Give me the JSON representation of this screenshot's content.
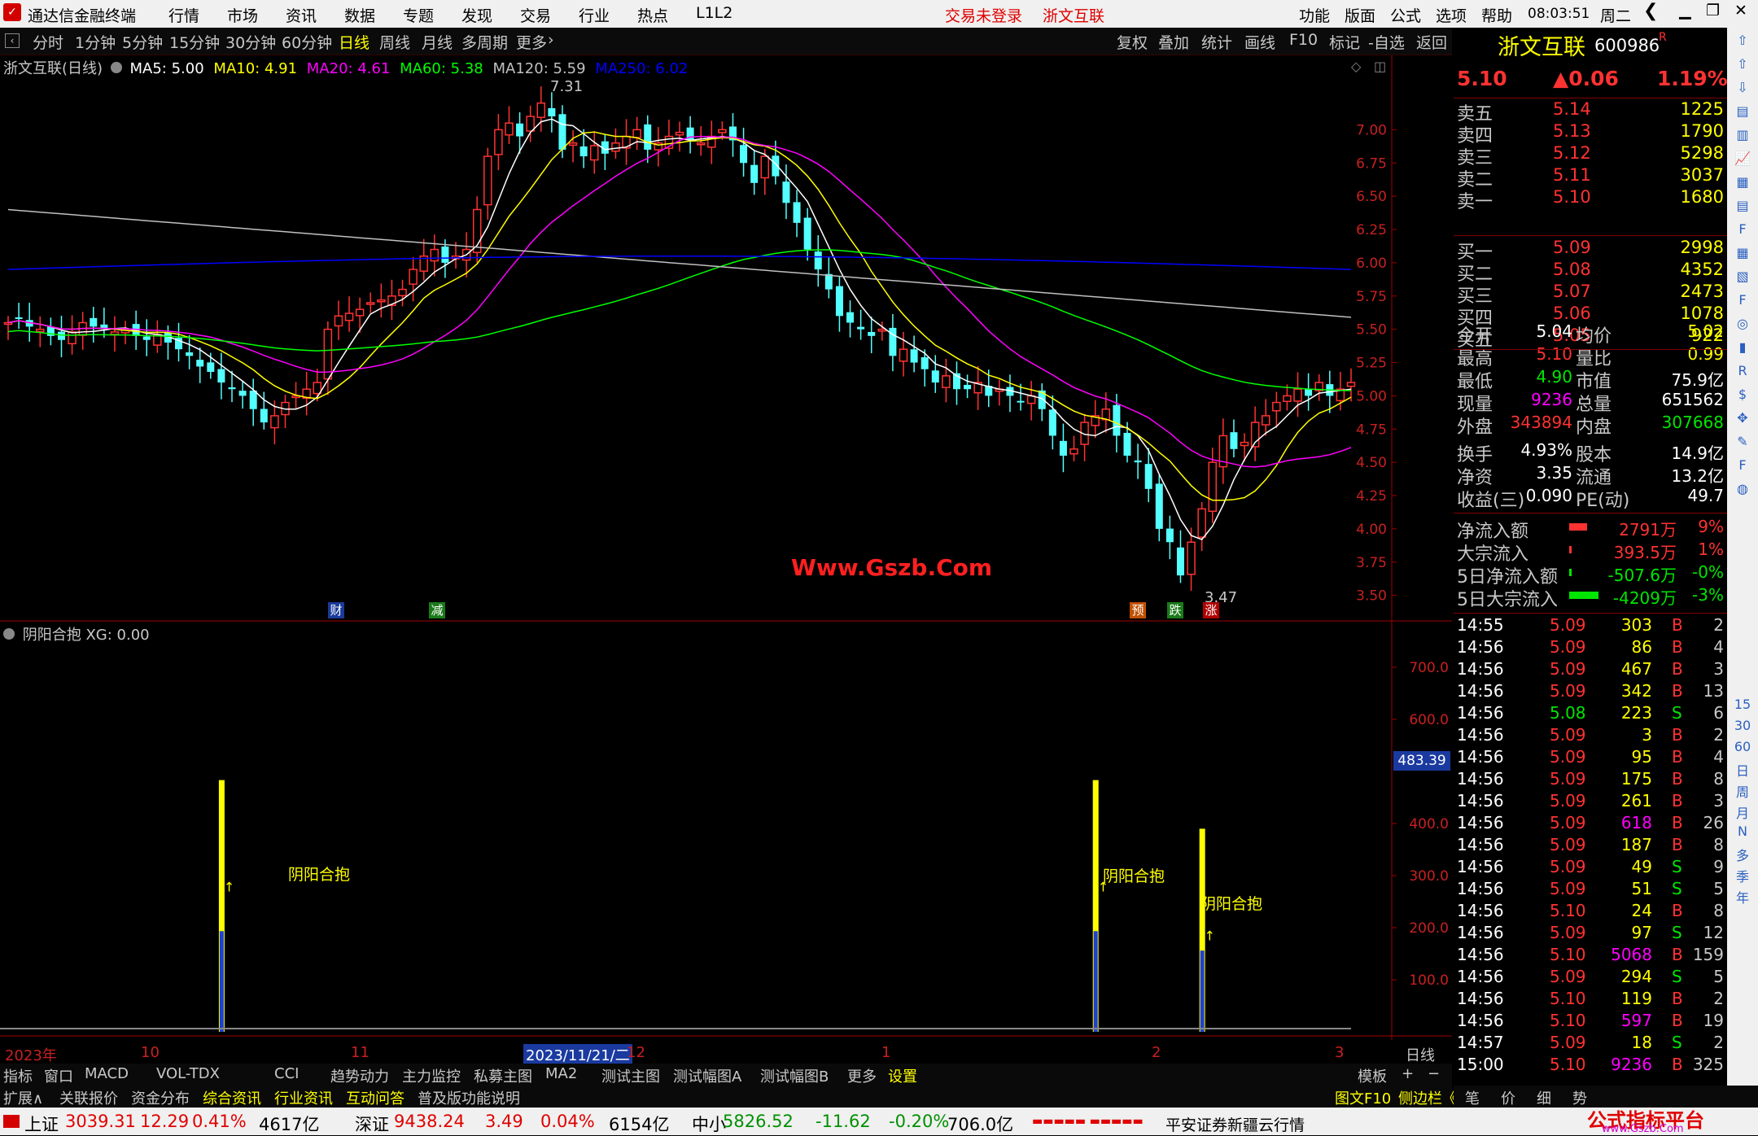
{
  "app": {
    "title": "通达信金融终端",
    "menu": [
      "行情",
      "市场",
      "资讯",
      "数据",
      "专题",
      "发现",
      "交易",
      "行业",
      "热点",
      "L1L2"
    ],
    "login_status": "交易未登录",
    "stock_title": "浙文互联",
    "right_menu": [
      "功能",
      "版面",
      "公式",
      "选项",
      "帮助"
    ],
    "time": "08:03:51",
    "weekday": "周二"
  },
  "periods": {
    "items": [
      "分时",
      "1分钟",
      "5分钟",
      "15分钟",
      "30分钟",
      "60分钟",
      "日线",
      "周线",
      "月线",
      "多周期",
      "更多"
    ],
    "active": "日线",
    "tools": [
      "复权",
      "叠加",
      "统计",
      "画线",
      "F10",
      "标记",
      "-自选",
      "返回"
    ]
  },
  "main_chart": {
    "name": "浙文互联(日线)",
    "ma": [
      {
        "label": "MA5: 5.00",
        "color": "#ffffff"
      },
      {
        "label": "MA10: 4.91",
        "color": "#ffff00"
      },
      {
        "label": "MA20: 4.61",
        "color": "#ff00ff"
      },
      {
        "label": "MA60: 5.38",
        "color": "#00ff00"
      },
      {
        "label": "MA120: 5.59",
        "color": "#c0c0c0"
      },
      {
        "label": "MA250: 6.02",
        "color": "#0000ff"
      }
    ],
    "y_ticks": [
      "7.00",
      "6.75",
      "6.50",
      "6.25",
      "6.00",
      "5.75",
      "5.50",
      "5.25",
      "5.00",
      "4.75",
      "4.50",
      "4.25",
      "4.00",
      "3.75",
      "3.50"
    ],
    "high_label": "7.31",
    "low_label": "3.47",
    "watermark": "Www.Gszb.Com",
    "markers": [
      {
        "text": "财",
        "bg": "#1a3a9a"
      },
      {
        "text": "减",
        "bg": "#1a7a1a"
      },
      {
        "text": "预",
        "bg": "#c05000"
      },
      {
        "text": "跌",
        "bg": "#1a7a1a"
      },
      {
        "text": "涨",
        "bg": "#b00000"
      }
    ]
  },
  "chart_data": [
    {
      "type": "candlestick",
      "title": "浙文互联(日线)",
      "ylim": [
        3.4,
        7.4
      ],
      "y_ticks": [
        3.5,
        3.75,
        4.0,
        4.25,
        4.5,
        4.75,
        5.0,
        5.25,
        5.5,
        5.75,
        6.0,
        6.25,
        6.5,
        6.75,
        7.0
      ],
      "x_labels": [
        "2023年",
        "10",
        "11",
        "2023/11/21/二",
        "12",
        "1",
        "2",
        "3"
      ],
      "high": 7.31,
      "low": 3.47,
      "closes": [
        5.55,
        5.58,
        5.52,
        5.5,
        5.45,
        5.42,
        5.48,
        5.55,
        5.52,
        5.5,
        5.48,
        5.5,
        5.45,
        5.42,
        5.46,
        5.4,
        5.35,
        5.3,
        5.22,
        5.18,
        5.1,
        5.05,
        5.0,
        4.9,
        4.8,
        4.85,
        4.95,
        5.0,
        5.05,
        5.1,
        5.5,
        5.6,
        5.62,
        5.65,
        5.7,
        5.72,
        5.75,
        5.8,
        5.95,
        6.05,
        6.1,
        6.0,
        6.05,
        6.1,
        6.4,
        6.8,
        7.0,
        7.05,
        6.95,
        7.1,
        7.2,
        7.1,
        6.85,
        6.9,
        6.8,
        6.88,
        6.82,
        6.9,
        6.95,
        7.0,
        6.85,
        6.9,
        6.95,
        6.98,
        6.92,
        6.9,
        6.95,
        7.0,
        6.92,
        6.75,
        6.6,
        6.8,
        6.65,
        6.45,
        6.3,
        6.1,
        5.95,
        5.8,
        5.6,
        5.55,
        5.5,
        5.45,
        5.5,
        5.3,
        5.35,
        5.25,
        5.2,
        5.1,
        5.15,
        5.05,
        5.05,
        5.1,
        5.0,
        5.05,
        5.0,
        4.95,
        5.0,
        4.9,
        4.7,
        4.55,
        4.6,
        4.8,
        4.85,
        4.9,
        4.7,
        4.55,
        4.5,
        4.3,
        4.0,
        3.9,
        3.65,
        3.9,
        4.15,
        4.5,
        4.7,
        4.6,
        4.65,
        4.8,
        4.85,
        4.95,
        5.0,
        5.05,
        5.0,
        5.1,
        5.0,
        5.05,
        5.1
      ],
      "series": [
        {
          "name": "MA5",
          "last": 5.0,
          "color": "#ffffff"
        },
        {
          "name": "MA10",
          "last": 4.91,
          "color": "#ffff00"
        },
        {
          "name": "MA20",
          "last": 4.61,
          "color": "#ff00ff"
        },
        {
          "name": "MA60",
          "last": 5.38,
          "color": "#00ff00"
        },
        {
          "name": "MA120",
          "last": 5.59,
          "color": "#c0c0c0"
        },
        {
          "name": "MA250",
          "last": 6.02,
          "color": "#0000ff"
        }
      ]
    },
    {
      "type": "bar",
      "title": "阴阳合抱 XG: 0.00",
      "ylim": [
        0,
        750
      ],
      "y_ticks": [
        100.0,
        200.0,
        300.0,
        400.0,
        600.0,
        700.0
      ],
      "current_value": "483.39",
      "signals": [
        {
          "bar_index": 20,
          "value": 483.39,
          "label": "阴阳合抱"
        },
        {
          "bar_index": 102,
          "value": 483.39,
          "label": "阴阳合抱"
        },
        {
          "bar_index": 112,
          "value": 390.0,
          "label": "阴阳合抱"
        }
      ]
    }
  ],
  "indicator": {
    "title": "阴阳合抱 XG: 0.00",
    "y_ticks": [
      "700.0",
      "600.0",
      "400.0",
      "300.0",
      "200.0",
      "100.0"
    ],
    "current_value": "483.39",
    "signal_label": "阴阳合抱",
    "right_tag": "日线"
  },
  "x_axis": {
    "labels": [
      "2023年",
      "10",
      "11",
      "2023/11/21/二",
      "12",
      "1",
      "2",
      "3"
    ]
  },
  "quote": {
    "name": "浙文互联",
    "code": "600986",
    "badge": "R",
    "price": "5.10",
    "change": "▲0.06",
    "change_pct": "1.19%",
    "asks": [
      {
        "label": "卖五",
        "price": "5.14",
        "vol": "1225"
      },
      {
        "label": "卖四",
        "price": "5.13",
        "vol": "1790"
      },
      {
        "label": "卖三",
        "price": "5.12",
        "vol": "5298"
      },
      {
        "label": "卖二",
        "price": "5.11",
        "vol": "3037"
      },
      {
        "label": "卖一",
        "price": "5.10",
        "vol": "1680"
      }
    ],
    "bids": [
      {
        "label": "买一",
        "price": "5.09",
        "vol": "2998"
      },
      {
        "label": "买二",
        "price": "5.08",
        "vol": "4352"
      },
      {
        "label": "买三",
        "price": "5.07",
        "vol": "2473"
      },
      {
        "label": "买四",
        "price": "5.06",
        "vol": "1078"
      },
      {
        "label": "买五",
        "price": "5.05",
        "vol": "922"
      }
    ],
    "stats": [
      {
        "l1": "今开",
        "v1": "5.04",
        "c1": "#ffffff",
        "l2": "均价",
        "v2": "5.02",
        "c2": "#ffff00"
      },
      {
        "l1": "最高",
        "v1": "5.10",
        "c1": "#ff3232",
        "l2": "量比",
        "v2": "0.99",
        "c2": "#ffff00"
      },
      {
        "l1": "最低",
        "v1": "4.90",
        "c1": "#00e600",
        "l2": "市值",
        "v2": "75.9亿",
        "c2": "#ffffff"
      },
      {
        "l1": "现量",
        "v1": "9236",
        "c1": "#ff00ff",
        "l2": "总量",
        "v2": "651562",
        "c2": "#ffffff"
      },
      {
        "l1": "外盘",
        "v1": "343894",
        "c1": "#ff3232",
        "l2": "内盘",
        "v2": "307668",
        "c2": "#00e600"
      }
    ],
    "stats2": [
      {
        "l1": "换手",
        "v1": "4.93%",
        "l2": "股本",
        "v2": "14.9亿"
      },
      {
        "l1": "净资",
        "v1": "3.35",
        "l2": "流通",
        "v2": "13.2亿"
      },
      {
        "l1": "收益(三)",
        "v1": "0.090",
        "l2": "PE(动)",
        "v2": "49.7"
      }
    ],
    "flows": [
      {
        "label": "净流入额",
        "value": "2791万",
        "pct": "9%",
        "color": "#ff3232",
        "bar": "red-wide"
      },
      {
        "label": "大宗流入",
        "value": "393.5万",
        "pct": "1%",
        "color": "#ff3232",
        "bar": "red-thin"
      },
      {
        "label": "5日净流入额",
        "value": "-507.6万",
        "pct": "-0%",
        "color": "#00e600",
        "bar": "green-thin"
      },
      {
        "label": "5日大宗流入",
        "value": "-4209万",
        "pct": "-3%",
        "color": "#00e600",
        "bar": "green-wide"
      }
    ],
    "ticks": [
      {
        "t": "14:55",
        "p": "5.09",
        "v": "303",
        "s": "B",
        "n": "2"
      },
      {
        "t": "14:56",
        "p": "5.09",
        "v": "86",
        "s": "B",
        "n": "4"
      },
      {
        "t": "14:56",
        "p": "5.09",
        "v": "467",
        "s": "B",
        "n": "3"
      },
      {
        "t": "14:56",
        "p": "5.09",
        "v": "342",
        "s": "B",
        "n": "13"
      },
      {
        "t": "14:56",
        "p": "5.08",
        "v": "223",
        "s": "S",
        "n": "6"
      },
      {
        "t": "14:56",
        "p": "5.09",
        "v": "3",
        "s": "B",
        "n": "2"
      },
      {
        "t": "14:56",
        "p": "5.09",
        "v": "95",
        "s": "B",
        "n": "4"
      },
      {
        "t": "14:56",
        "p": "5.09",
        "v": "175",
        "s": "B",
        "n": "8"
      },
      {
        "t": "14:56",
        "p": "5.09",
        "v": "261",
        "s": "B",
        "n": "3"
      },
      {
        "t": "14:56",
        "p": "5.09",
        "v": "618",
        "s": "B",
        "n": "26"
      },
      {
        "t": "14:56",
        "p": "5.09",
        "v": "187",
        "s": "B",
        "n": "8"
      },
      {
        "t": "14:56",
        "p": "5.09",
        "v": "49",
        "s": "S",
        "n": "9"
      },
      {
        "t": "14:56",
        "p": "5.09",
        "v": "51",
        "s": "S",
        "n": "5"
      },
      {
        "t": "14:56",
        "p": "5.10",
        "v": "24",
        "s": "B",
        "n": "8"
      },
      {
        "t": "14:56",
        "p": "5.09",
        "v": "97",
        "s": "S",
        "n": "12"
      },
      {
        "t": "14:56",
        "p": "5.10",
        "v": "5068",
        "s": "B",
        "n": "159"
      },
      {
        "t": "14:56",
        "p": "5.09",
        "v": "294",
        "s": "S",
        "n": "5"
      },
      {
        "t": "14:56",
        "p": "5.10",
        "v": "119",
        "s": "B",
        "n": "2"
      },
      {
        "t": "14:56",
        "p": "5.10",
        "v": "597",
        "s": "B",
        "n": "19"
      },
      {
        "t": "14:57",
        "p": "5.09",
        "v": "18",
        "s": "S",
        "n": "2"
      },
      {
        "t": "15:00",
        "p": "5.10",
        "v": "9236",
        "s": "B",
        "n": "325"
      }
    ]
  },
  "side_tools": [
    "15",
    "30",
    "60",
    "日",
    "周",
    "月",
    "N",
    "多",
    "季",
    "年"
  ],
  "tabs1": {
    "items": [
      "指标",
      "窗口",
      "MACD",
      "VOL-TDX",
      "CCI",
      "趋势动力",
      "主力监控",
      "私募主图",
      "MA2",
      "测试主图",
      "测试幅图A",
      "测试幅图B",
      "更多",
      "设置"
    ],
    "right": [
      "模板",
      "+",
      "−"
    ]
  },
  "tabs2": {
    "items": [
      "扩展∧",
      "关联报价",
      "资金分布",
      "综合资讯",
      "行业资讯",
      "互动问答",
      "普及版功能说明"
    ],
    "right": "图文F10",
    "right2": "侧边栏《"
  },
  "bottomstrip": [
    "笔",
    "价",
    "细",
    "势"
  ],
  "statusbar": {
    "items": [
      {
        "name": "上证",
        "val": "3039.31",
        "chg": "12.29",
        "pct": "0.41%",
        "amt": "4617亿"
      },
      {
        "name": "深证",
        "val": "9438.24",
        "chg": "3.49",
        "pct": "0.04%",
        "amt": "6154亿"
      },
      {
        "name": "中小",
        "val": "5826.52",
        "chg": "-11.62",
        "pct": "-0.20%",
        "amt": "706.0亿"
      }
    ],
    "broker": "平安证券新疆云行情",
    "brand": "公式指标平台",
    "brand_url": "www.Gszb.Com"
  }
}
